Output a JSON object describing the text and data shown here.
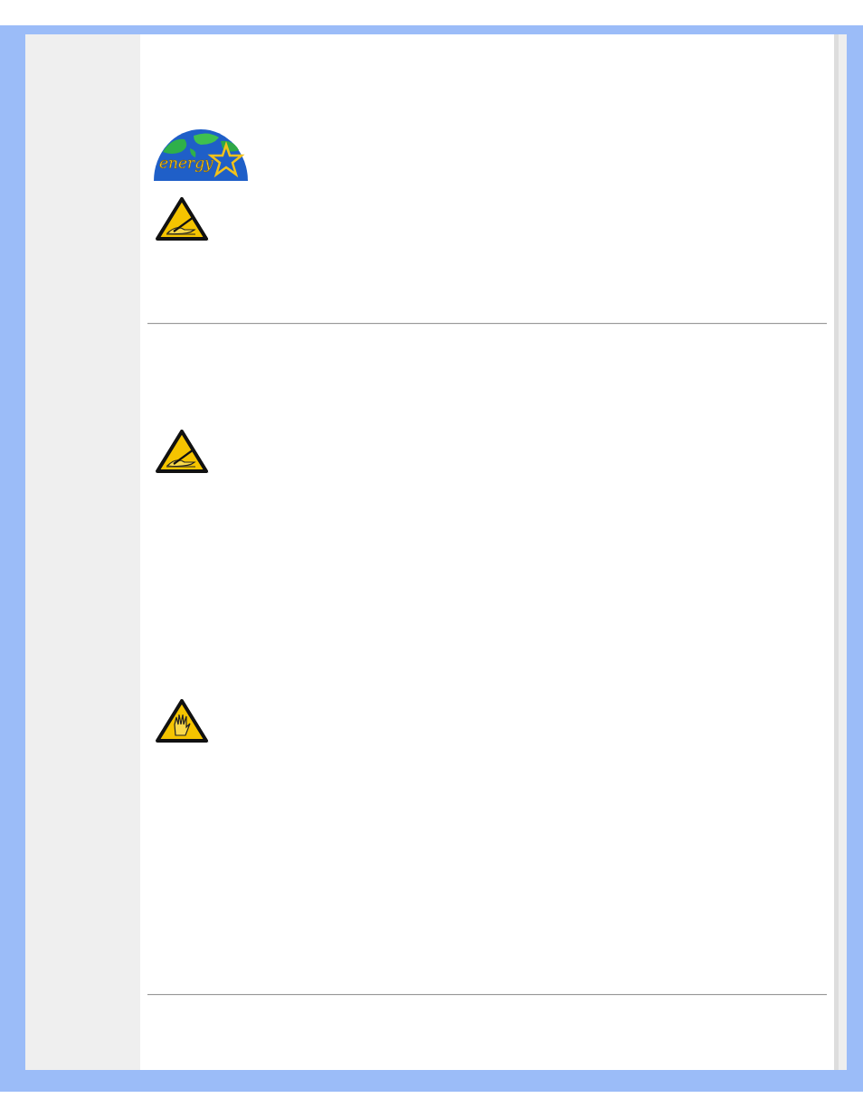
{
  "sections": [
    {
      "items": [
        {
          "kind": "energy-logo",
          "text": "energy"
        },
        {
          "kind": "note"
        }
      ]
    },
    {
      "items": [
        {
          "kind": "note"
        },
        {
          "kind": "warning"
        }
      ]
    }
  ]
}
